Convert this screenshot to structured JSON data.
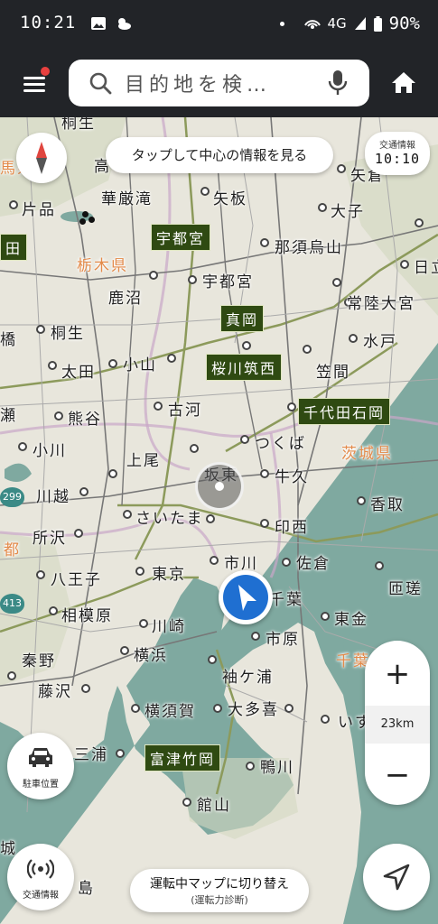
{
  "status_bar": {
    "time": "10:21",
    "network": "4G",
    "battery": "90%"
  },
  "app_bar": {
    "search_placeholder": "目的地を検…",
    "icons": [
      "menu-icon",
      "search-icon",
      "mic-icon",
      "home-icon"
    ]
  },
  "overlays": {
    "center_hint": "タップして中心の情報を見る",
    "traffic_label": "交通情報",
    "traffic_time": "10:10",
    "scale": "23km",
    "zoom_in": "+",
    "zoom_out": "−",
    "parking_label": "駐車位置",
    "traffic_button_label": "交通情報",
    "drive_mode_label": "運転中マップに切り替え",
    "drive_mode_sub": "(運転力診断)"
  },
  "map": {
    "prefectures": {
      "tochigi": "栃木県",
      "ibaraki": "茨城県",
      "tokyo_to": "都",
      "chiba_partial": "千葉",
      "gunma_partial": "馬県"
    },
    "route_shields": {
      "r299": "299",
      "r413": "413"
    },
    "interchange_tags": {
      "utsunomiya": "宇都宮",
      "moka": "真岡",
      "sakuragawa": "桜川筑西",
      "chiyoda": "千代田石岡",
      "futtsu": "富津竹岡",
      "left_edge": "田"
    },
    "cities": {
      "kiryu_top": "桐生",
      "taka": "高",
      "yaita": "矢板",
      "nasu": "那須烏山",
      "kegon": "華厳滝",
      "katakura": "片品",
      "utsunomiya": "宇都宮",
      "ohtawara": "大子",
      "yakeru": "矢倉",
      "kanuma": "鹿沼",
      "hitachiomiya": "常陸大宮",
      "hitachi": "日立",
      "kiryu": "桐生",
      "hashi": "橋",
      "ota": "太田",
      "oyama": "小山",
      "mito": "水戸",
      "kasama": "笠間",
      "koga": "古河",
      "kumagaya": "熊谷",
      "seta": "瀬",
      "tsukuba": "つくば",
      "ogawa": "小川",
      "ageo": "上尾",
      "bando": "坂東",
      "ushiku": "牛久",
      "kawagoe": "川越",
      "katori": "香取",
      "tokorozawa": "所沢",
      "saitama": "さいたま",
      "inzai": "印西",
      "sakura": "佐倉",
      "hachioji": "八王子",
      "tokyo": "東京",
      "ichikawa": "市川",
      "sosa": "匝瑳",
      "chiba": "千葉",
      "sagamihara": "相模原",
      "kawasaki": "川崎",
      "ichihara": "市原",
      "togane": "東金",
      "hadano": "秦野",
      "yokohama": "横浜",
      "fujisawa": "藤沢",
      "sodegaura": "袖ケ浦",
      "yokosuka": "横須賀",
      "otaki": "大多喜",
      "isumi": "いす",
      "miura": "三浦",
      "kamogawa": "鴨川",
      "tateyama": "館山",
      "oshima": "島",
      "jo": "城"
    }
  }
}
